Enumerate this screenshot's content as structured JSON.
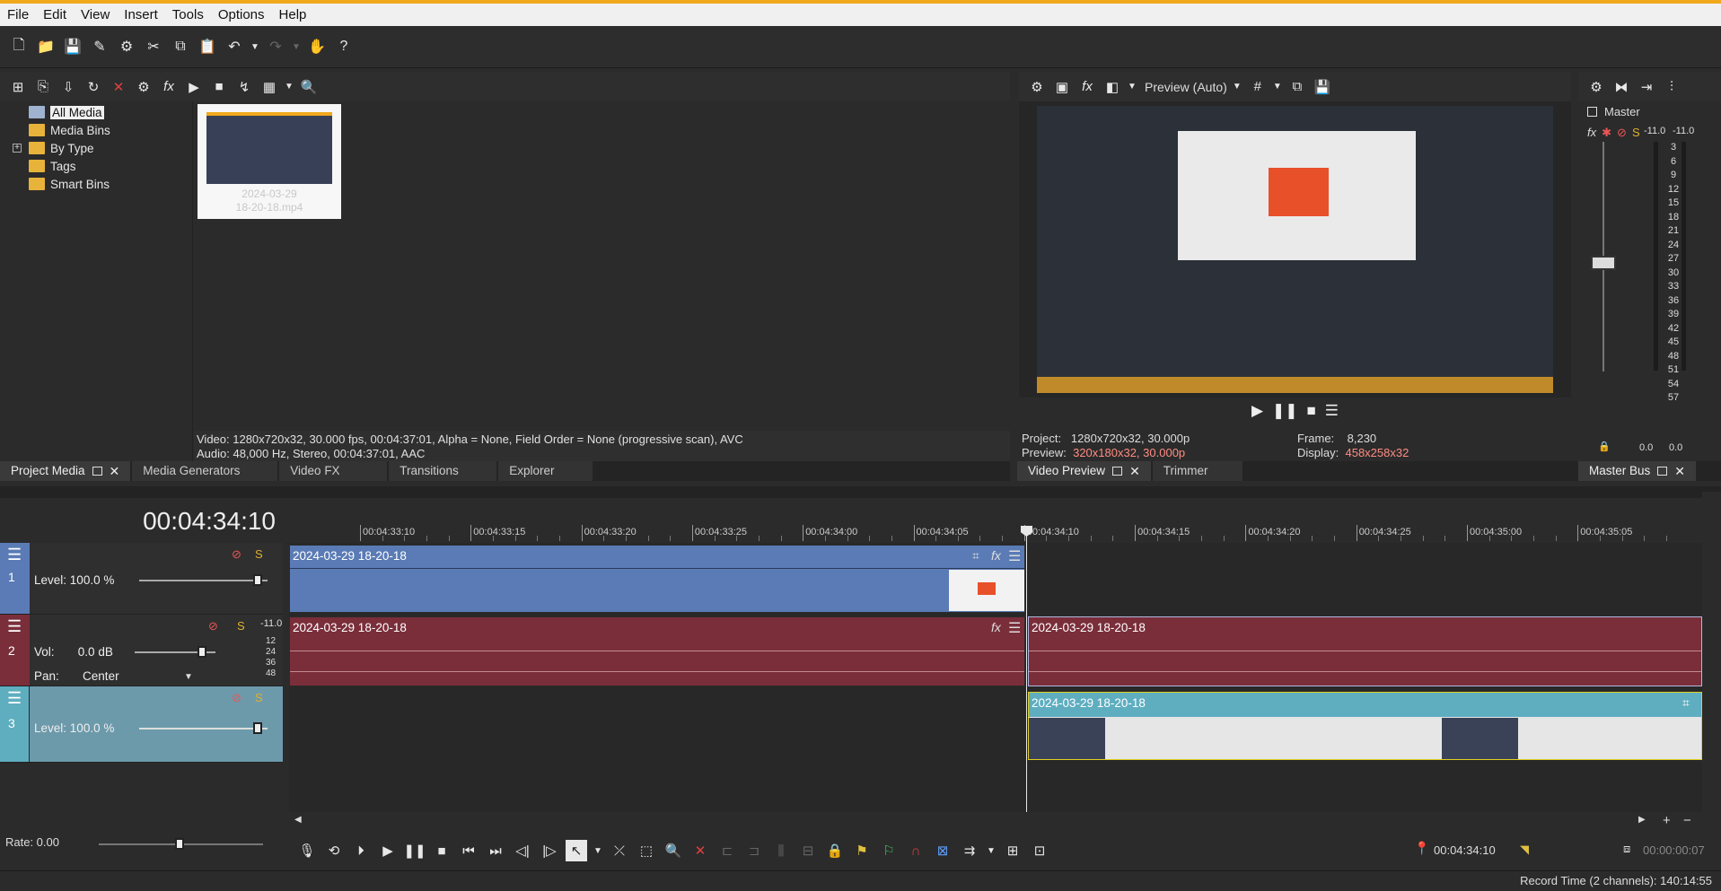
{
  "menu": [
    "File",
    "Edit",
    "View",
    "Insert",
    "Tools",
    "Options",
    "Help"
  ],
  "project_media": {
    "tree": [
      "All Media",
      "Media Bins",
      "By Type",
      "Tags",
      "Smart Bins"
    ],
    "thumb_caption_line1": "2024-03-29",
    "thumb_caption_line2": "18-20-18.mp4",
    "info_video": "Video: 1280x720x32, 30.000 fps, 00:04:37:01, Alpha = None, Field Order = None (progressive scan), AVC",
    "info_audio": "Audio: 48,000 Hz, Stereo, 00:04:37:01, AAC",
    "tabs": [
      "Project Media",
      "Media Generators",
      "Video FX",
      "Transitions",
      "Explorer"
    ]
  },
  "video_preview": {
    "mode": "Preview (Auto)",
    "project_label": "Project:",
    "project_value": "1280x720x32, 30.000p",
    "preview_label": "Preview:",
    "preview_value": "320x180x32, 30.000p",
    "frame_label": "Frame:",
    "frame_value": "8,230",
    "display_label": "Display:",
    "display_value": "458x258x32",
    "tabs": [
      "Video Preview",
      "Trimmer"
    ]
  },
  "master_bus": {
    "title": "Master",
    "peak_left": "-11.0",
    "peak_right": "-11.0",
    "scale": [
      "3",
      "6",
      "9",
      "12",
      "15",
      "18",
      "21",
      "24",
      "27",
      "30",
      "33",
      "36",
      "39",
      "42",
      "45",
      "48",
      "51",
      "54",
      "57"
    ],
    "level_left": "0.0",
    "level_right": "0.0",
    "tab": "Master Bus"
  },
  "timeline": {
    "timecode": "00:04:34:10",
    "ruler": [
      "00:04:33:10",
      "00:04:33:15",
      "00:04:33:20",
      "00:04:33:25",
      "00:04:34:00",
      "00:04:34:05",
      "00:04:34:10",
      "00:04:34:15",
      "00:04:34:20",
      "00:04:34:25",
      "00:04:35:00",
      "00:04:35:05"
    ],
    "tracks": [
      {
        "num": "1",
        "level_label": "Level:",
        "level_value": "100.0 %",
        "clip": "2024-03-29 18-20-18"
      },
      {
        "num": "2",
        "vol_label": "Vol:",
        "vol_value": "0.0 dB",
        "pan_label": "Pan:",
        "pan_value": "Center",
        "peak": "-11.0",
        "scale": [
          "12",
          "24",
          "36",
          "48"
        ],
        "clip_a": "2024-03-29 18-20-18",
        "clip_b": "2024-03-29 18-20-18"
      },
      {
        "num": "3",
        "level_label": "Level:",
        "level_value": "100.0 %",
        "clip": "2024-03-29 18-20-18"
      }
    ]
  },
  "bottom": {
    "rate": "Rate: 0.00",
    "cursor_time": "00:04:34:10",
    "selection_length": "00:00:00:07",
    "status": "Record Time (2 channels): 140:14:55"
  },
  "colors": {
    "accent": "#f0a81c",
    "video_track": "#5a7bb5",
    "audio_track": "#7a2e3a",
    "video_track3": "#5eaec0"
  }
}
